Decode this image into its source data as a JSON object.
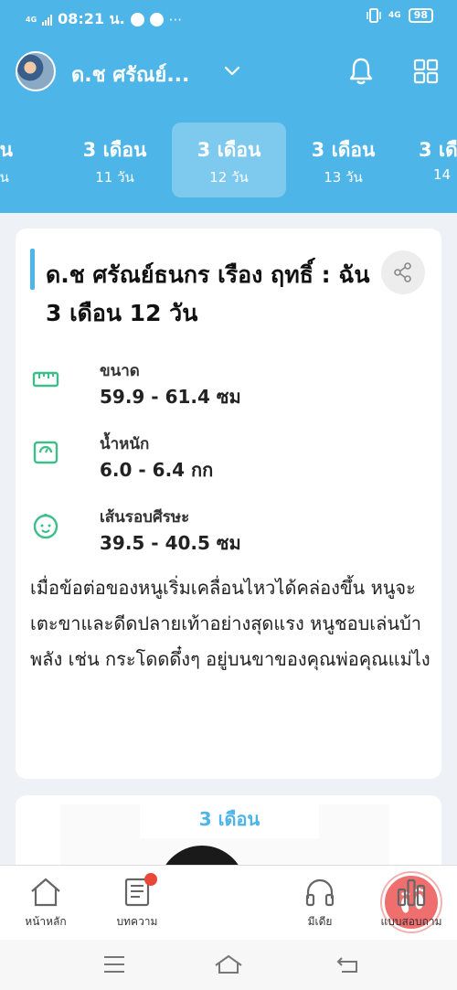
{
  "status_bar": {
    "network": "4G",
    "time": "08:21 น.",
    "more": "···",
    "right_network": "4G",
    "battery": "98"
  },
  "header": {
    "child_name": "ด.ช ศรัณย์...",
    "age_tabs": [
      {
        "main": "ือน",
        "sub": "วัน",
        "active": false
      },
      {
        "main": "3 เดือน",
        "sub": "11 วัน",
        "active": false
      },
      {
        "main": "3 เดือน",
        "sub": "12 วัน",
        "active": true
      },
      {
        "main": "3 เดือน",
        "sub": "13 วัน",
        "active": false
      },
      {
        "main": "3 เดื",
        "sub": "14",
        "active": false
      }
    ]
  },
  "card": {
    "title": "ด.ช ศรัณย์ธนกร เรือง ฤทธิ์ : ฉัน 3 เดือน 12 วัน",
    "metrics": [
      {
        "label": "ขนาด",
        "value": "59.9 - 61.4 ซม",
        "icon": "ruler-icon"
      },
      {
        "label": "น้ำหนัก",
        "value": "6.0 - 6.4 กก",
        "icon": "scale-icon"
      },
      {
        "label": "เส้นรอบศีรษะ",
        "value": "39.5 - 40.5 ซม",
        "icon": "baby-face-icon"
      }
    ],
    "description": "เมื่อข้อต่อของหนูเริ่มเคลื่อนไหวได้คล่องขึ้น หนูจะเตะขาและดีดปลายเท้าอย่างสุดแรง หนูชอบเล่นบ้าพลัง เช่น กระโดดดึ๋งๆ อยู่บนขาของคุณพ่อคุณแม่ไง"
  },
  "card2": {
    "label": "3 เดือน"
  },
  "bottom_nav": {
    "items": [
      {
        "label": "หน้าหลัก",
        "icon": "home-icon"
      },
      {
        "label": "บทความ",
        "icon": "article-icon"
      },
      {
        "label": "",
        "icon": "footprints-icon"
      },
      {
        "label": "มีเดีย",
        "icon": "headphones-icon"
      },
      {
        "label": "แบบสอบถาม",
        "icon": "bar-chart-icon"
      }
    ]
  },
  "colors": {
    "primary": "#4db5e8",
    "accent_green": "#3cbf8a",
    "center_button": "#ef6e6e",
    "badge": "#e8473a"
  }
}
